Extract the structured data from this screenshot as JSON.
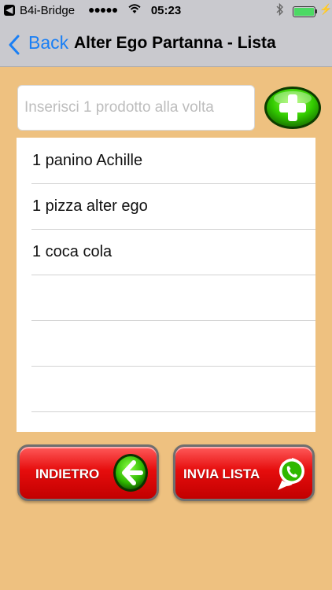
{
  "status_bar": {
    "carrier": "B4i-Bridge",
    "signal": "●●●●●",
    "time": "05:23"
  },
  "nav": {
    "back_label": "Back",
    "title": "Alter Ego Partanna - Lista"
  },
  "input": {
    "placeholder": "Inserisci 1 prodotto alla volta",
    "value": ""
  },
  "list": {
    "items": [
      "1 panino Achille",
      "1 pizza alter ego",
      "1 coca cola",
      "",
      "",
      "",
      ""
    ]
  },
  "buttons": {
    "back_label": "INDIETRO",
    "send_label": "INVIA LISTA"
  },
  "colors": {
    "background": "#eec180",
    "accent_blue": "#1a7ff5",
    "button_red": "#e60d0d",
    "add_green": "#33cc00"
  }
}
